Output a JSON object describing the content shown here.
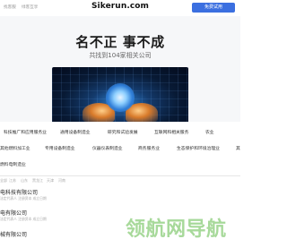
{
  "header": {
    "nav": [
      "找客服",
      "绿客互享"
    ],
    "logo": "Sikerun.com",
    "cta": "免费试用"
  },
  "hero": {
    "headline": "名不正 事不成",
    "subhead": "共找到104家相关公司"
  },
  "categories": [
    [
      "科技推广和应用服务业",
      "通用设备制造业",
      "研究和试验发展",
      "互联网和相关服务",
      "农业"
    ],
    [
      "其他燃料加工业",
      "专用设备制造业",
      "仪器仪表制造业",
      "商务服务业",
      "生态保护和环境治理业",
      "其"
    ],
    [
      "燃料电制造业"
    ]
  ],
  "filters": [
    "全部",
    "江苏",
    "山东",
    "黑龙江",
    "天津",
    "河南"
  ],
  "list": [
    {
      "title": "电科技有限公司",
      "sub": "法定代表人 注册资本 成立日期"
    },
    {
      "title": "电有限公司",
      "sub": "法定代表人 注册资本 成立日期"
    },
    {
      "title": "械有限公司",
      "sub": ""
    }
  ],
  "watermark": "领航网导航"
}
